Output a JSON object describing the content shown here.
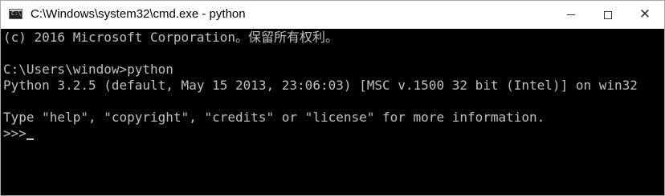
{
  "window": {
    "title": "C:\\Windows\\system32\\cmd.exe - python",
    "icon": "cmd-icon",
    "icon_text": "C:\\"
  },
  "controls": {
    "minimize_icon": "minimize-icon",
    "maximize_icon": "maximize-icon",
    "close_icon": "close-icon",
    "close_glyph": "✕"
  },
  "console": {
    "lines": [
      "(c) 2016 Microsoft Corporation。保留所有权利。",
      "",
      "C:\\Users\\window>python",
      "Python 3.2.5 (default, May 15 2013, 23:06:03) [MSC v.1500 32 bit (Intel)] on win32",
      "",
      "Type \"help\", \"copyright\", \"credits\" or \"license\" for more information."
    ],
    "prompt": ">>>"
  },
  "colors": {
    "console_bg": "#000000",
    "console_fg": "#c0c0c0",
    "titlebar_bg": "#ffffff"
  }
}
